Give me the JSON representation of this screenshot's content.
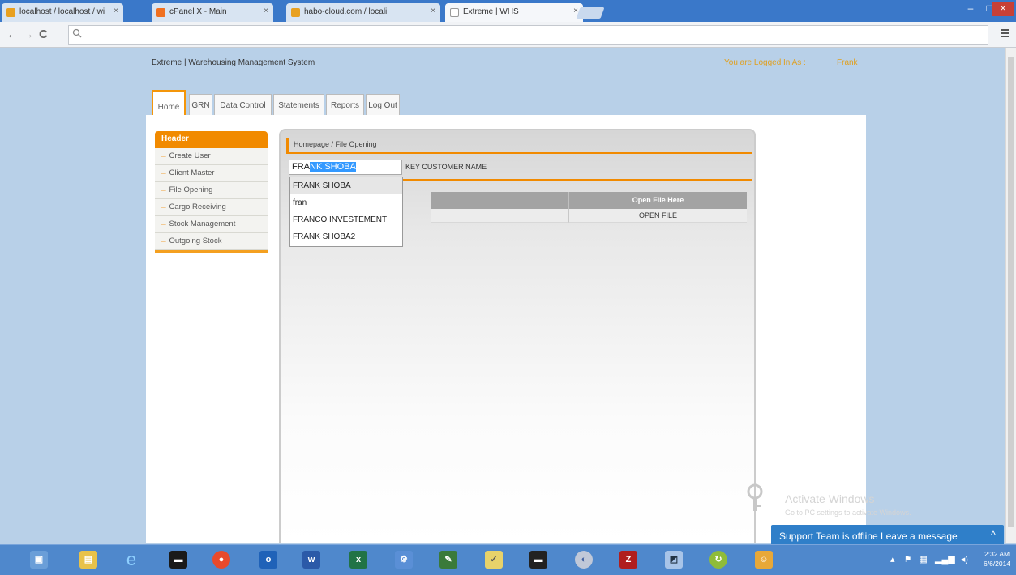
{
  "browser": {
    "tabs": [
      {
        "label": "localhost / localhost / wi",
        "favicon_color": "#e8a020"
      },
      {
        "label": "cPanel X - Main",
        "favicon_color": "#f07020"
      },
      {
        "label": "habo-cloud.com / locali",
        "favicon_color": "#e8a020"
      },
      {
        "label": "Extreme | WHS",
        "favicon_color": "#ffffff"
      }
    ],
    "close_glyph": "×",
    "window_controls": {
      "minimize": "–",
      "maximize": "□",
      "close": "×"
    },
    "nav": {
      "back": "←",
      "forward": "→",
      "reload": "C"
    },
    "omnibox_icon": "search-icon",
    "menu_icon": "hamburger-icon"
  },
  "header": {
    "site_title": "Extreme | Warehousing Management System",
    "logged_in_label": "You are Logged In As :",
    "user_name": "Frank"
  },
  "main_tabs": [
    "Home",
    "GRN",
    "Data Control",
    "Statements",
    "Reports",
    "Log Out"
  ],
  "sidebar": {
    "heading": "Header",
    "items": [
      "Create User",
      "Client Master",
      "File Opening",
      "Cargo Receiving",
      "Stock Management",
      "Outgoing Stock"
    ]
  },
  "panel": {
    "breadcrumb": "Homepage / File Opening",
    "search": {
      "typed": "FRA",
      "selected": "NK SHOBA"
    },
    "search_label": "KEY CUSTOMER NAME",
    "suggestions": [
      "FRANK SHOBA",
      "fran",
      "FRANCO INVESTEMENT",
      "FRANK SHOBA2"
    ],
    "table": {
      "header": "Open File Here",
      "row": "OPEN FILE"
    }
  },
  "activate": {
    "title": "Activate Windows",
    "subtitle": "Go to PC settings to activate Windows."
  },
  "support": {
    "text": "Support Team is offline Leave a message",
    "chevron": "^"
  },
  "taskbar": {
    "icons": [
      "explorer-icon",
      "file-manager-icon",
      "internet-explorer-icon",
      "terminal-icon",
      "chrome-icon",
      "outlook-icon",
      "word-icon",
      "excel-icon",
      "network-icon",
      "notepad-icon",
      "tasks-icon",
      "console-icon",
      "media-icon",
      "filezilla-icon",
      "remote-desktop-icon",
      "sync-icon",
      "users-icon"
    ],
    "clock_time": "2:32 AM",
    "clock_date": "6/6/2014"
  },
  "colors": {
    "accent_orange": "#f18a00",
    "taskbar_blue": "#4f88cc",
    "chrome_blue": "#3a78c9",
    "support_blue": "#2f7fc9"
  }
}
